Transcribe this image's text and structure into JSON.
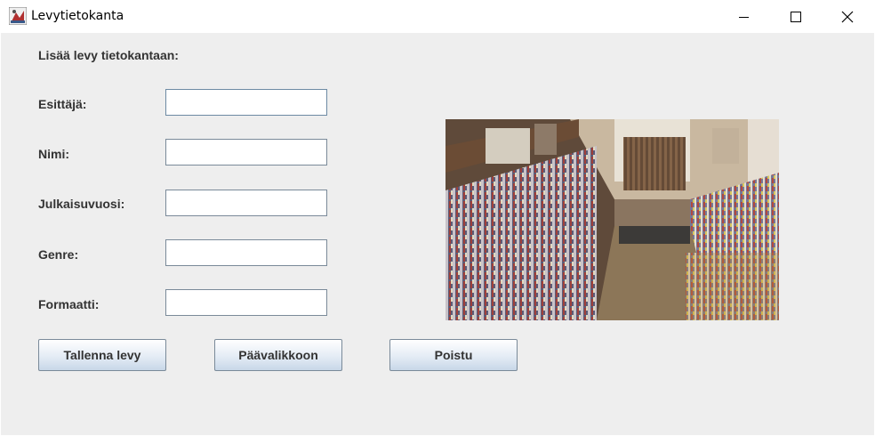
{
  "window": {
    "title": "Levytietokanta",
    "app_icon": "record-store-icon",
    "controls": [
      "minimize-icon",
      "maximize-icon",
      "close-icon"
    ]
  },
  "form": {
    "heading": "Lisää levy tietokantaan:",
    "fields": [
      {
        "label": "Esittäjä:",
        "value": "",
        "focused": true
      },
      {
        "label": "Nimi:",
        "value": ""
      },
      {
        "label": "Julkaisuvuosi:",
        "value": ""
      },
      {
        "label": "Genre:",
        "value": ""
      },
      {
        "label": "Formaatti:",
        "value": ""
      }
    ]
  },
  "buttons": {
    "save": "Tallenna levy",
    "main_menu": "Päävalikkoon",
    "exit": "Poistu"
  },
  "image": {
    "subject": "record-store-photo"
  },
  "colors": {
    "window_bg": "#eeeeee",
    "titlebar_bg": "#ffffff",
    "label_text": "#333333",
    "input_border": "#7a8a99",
    "button_gradient_top": "#ffffff",
    "button_gradient_bottom": "#c8d7e8"
  }
}
